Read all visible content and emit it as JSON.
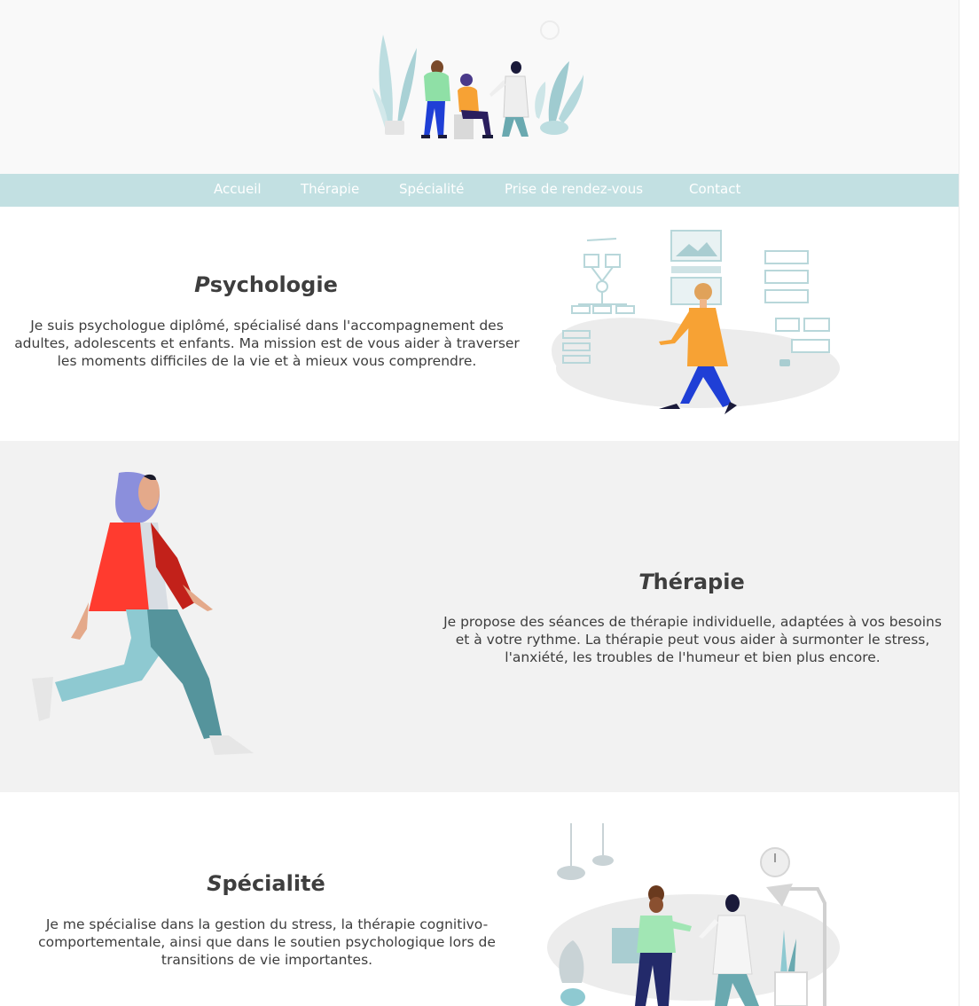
{
  "nav": {
    "items": [
      {
        "label": "Accueil"
      },
      {
        "label": "Thérapie"
      },
      {
        "label": "Spécialité"
      },
      {
        "label": "Prise de rendez-vous"
      },
      {
        "label": "Contact"
      }
    ]
  },
  "sections": {
    "psychologie": {
      "title_first": "P",
      "title_rest": "sychologie",
      "text": "Je suis psychologue diplômé, spécialisé dans l'accompagnement des adultes, adolescents et enfants. Ma mission est de vous aider à traverser les moments difficiles de la vie et à mieux vous comprendre."
    },
    "therapie": {
      "title_first": "T",
      "title_rest": "hérapie",
      "text": "Je propose des séances de thérapie individuelle, adaptées à vos besoins et à votre rythme. La thérapie peut vous aider à surmonter le stress, l'anxiété, les troubles de l'humeur et bien plus encore."
    },
    "specialite": {
      "title_first": "S",
      "title_rest": "pécialité",
      "text": "Je me spécialise dans la gestion du stress, la thérapie cognitivo-comportementale, ainsi que dans le soutien psychologique lors de transitions de vie importantes."
    }
  },
  "colors": {
    "nav_bg": "#c2e0e2",
    "section_alt_bg": "#f2f2f2",
    "heading": "#3e3e3e",
    "text": "#3d3d3d"
  },
  "illustrations": {
    "header": "therapy-session-illustration",
    "psychologie": "woman-walking-dashboard-illustration",
    "therapie": "walking-woman-hijab-illustration",
    "specialite": "doctor-patient-office-illustration"
  }
}
